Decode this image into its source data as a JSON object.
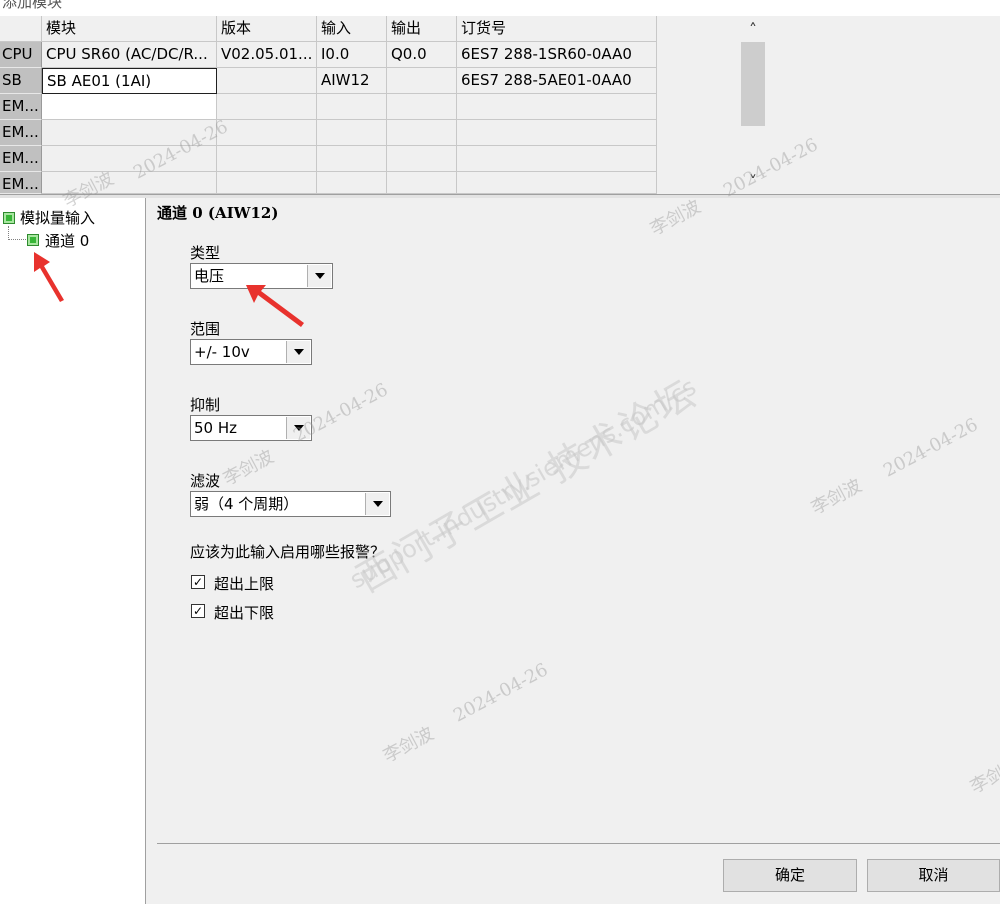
{
  "window": {
    "title": "添加模块"
  },
  "grid": {
    "headers": [
      "",
      "模块",
      "版本",
      "输入",
      "输出",
      "订货号"
    ],
    "rows": [
      [
        "CPU",
        "CPU SR60 (AC/DC/R...",
        "V02.05.01...",
        "I0.0",
        "Q0.0",
        "6ES7 288-1SR60-0AA0"
      ],
      [
        "SB",
        "SB AE01 (1AI)",
        "",
        "AIW12",
        "",
        "6ES7 288-5AE01-0AA0"
      ],
      [
        "EM...",
        "",
        "",
        "",
        "",
        ""
      ],
      [
        "EM...",
        "",
        "",
        "",
        "",
        ""
      ],
      [
        "EM...",
        "",
        "",
        "",
        "",
        ""
      ],
      [
        "EM...",
        "",
        "",
        "",
        "",
        ""
      ]
    ]
  },
  "tree": {
    "root": "模拟量输入",
    "child": "通道 0"
  },
  "panel": {
    "title": "通道 0 (AIW12)",
    "type_label": "类型",
    "type_value": "电压",
    "range_label": "范围",
    "range_value": "+/- 10v",
    "suppress_label": "抑制",
    "suppress_value": "50 Hz",
    "filter_label": "滤波",
    "filter_value": "弱（4 个周期）",
    "alarm_question": "应该为此输入启用哪些报警？",
    "alarms": [
      {
        "label": "超出上限",
        "checked": true
      },
      {
        "label": "超出下限",
        "checked": true
      }
    ],
    "check_mark": "✓"
  },
  "buttons": {
    "ok": "确定",
    "cancel": "取消"
  },
  "scroll": {
    "up": "˄",
    "down": "˅"
  },
  "watermarks": {
    "author": "李剑波",
    "date": "2024-04-26",
    "forum": "西门子工业 技术论坛",
    "url": "support.industry.siemens.com/cs"
  },
  "colors": {
    "annotation_arrow": "#e8322d",
    "tree_icon": "#37b637"
  }
}
